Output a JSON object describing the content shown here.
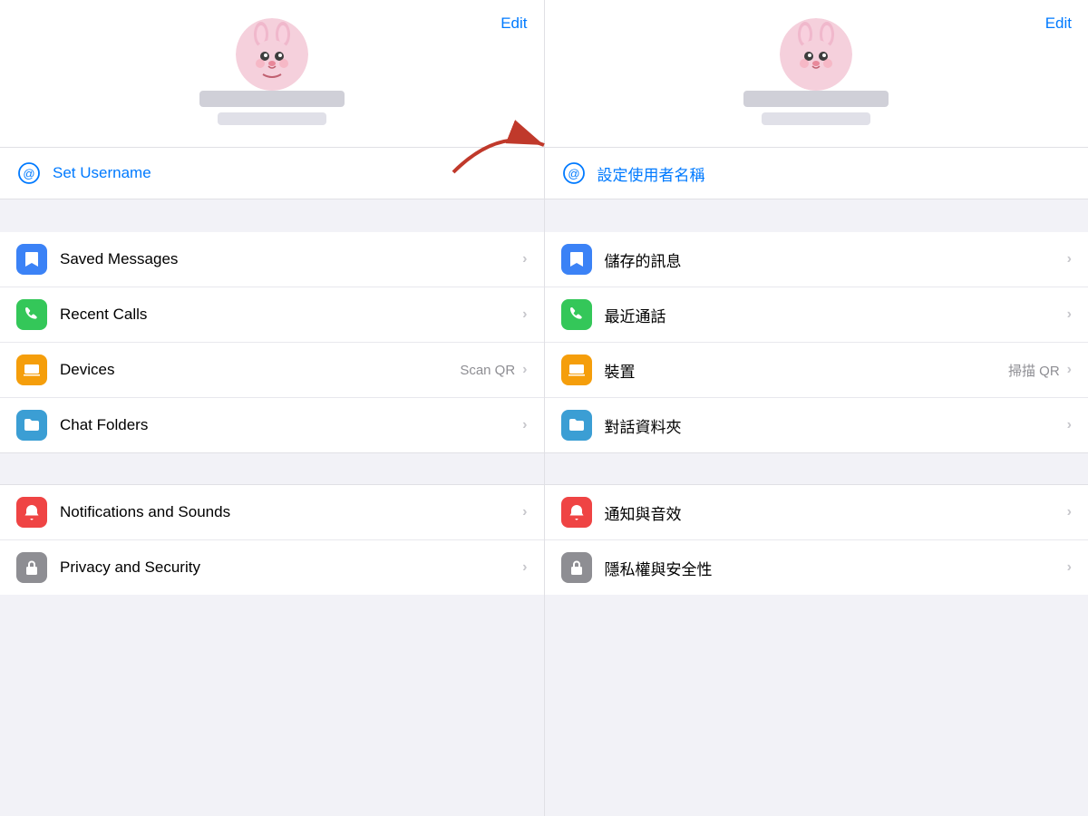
{
  "colors": {
    "blue": "#007aff",
    "green": "#34c759",
    "orange": "#f59e0b",
    "teal": "#3b9ed4",
    "red": "#ef4444",
    "gray": "#8e8e93"
  },
  "left_panel": {
    "edit_label": "Edit",
    "set_username_label": "Set Username",
    "menu_items": [
      {
        "id": "saved_messages",
        "label": "Saved Messages",
        "icon": "bookmark-icon",
        "icon_color": "blue",
        "secondary": "",
        "chevron": "›"
      },
      {
        "id": "recent_calls",
        "label": "Recent Calls",
        "icon": "phone-icon",
        "icon_color": "green",
        "secondary": "",
        "chevron": "›"
      },
      {
        "id": "devices",
        "label": "Devices",
        "icon": "laptop-icon",
        "icon_color": "orange",
        "secondary": "Scan QR",
        "chevron": "›"
      },
      {
        "id": "chat_folders",
        "label": "Chat Folders",
        "icon": "folder-icon",
        "icon_color": "teal",
        "secondary": "",
        "chevron": "›"
      }
    ],
    "menu_items2": [
      {
        "id": "notifications",
        "label": "Notifications and Sounds",
        "icon": "bell-icon",
        "icon_color": "red",
        "secondary": "",
        "chevron": "›"
      },
      {
        "id": "privacy",
        "label": "Privacy and Security",
        "icon": "lock-icon",
        "icon_color": "gray",
        "secondary": "",
        "chevron": "›"
      }
    ]
  },
  "right_panel": {
    "edit_label": "Edit",
    "set_username_label": "設定使用者名稱",
    "menu_items": [
      {
        "id": "saved_messages_zh",
        "label": "儲存的訊息",
        "icon": "bookmark-icon",
        "icon_color": "blue",
        "secondary": "",
        "chevron": "›"
      },
      {
        "id": "recent_calls_zh",
        "label": "最近通話",
        "icon": "phone-icon",
        "icon_color": "green",
        "secondary": "",
        "chevron": "›"
      },
      {
        "id": "devices_zh",
        "label": "裝置",
        "icon": "laptop-icon",
        "icon_color": "orange",
        "secondary": "掃描 QR",
        "chevron": "›"
      },
      {
        "id": "chat_folders_zh",
        "label": "對話資料夾",
        "icon": "folder-icon",
        "icon_color": "teal",
        "secondary": "",
        "chevron": "›"
      }
    ],
    "menu_items2": [
      {
        "id": "notifications_zh",
        "label": "通知與音效",
        "icon": "bell-icon",
        "icon_color": "red",
        "secondary": "",
        "chevron": "›"
      },
      {
        "id": "privacy_zh",
        "label": "隱私權與安全性",
        "icon": "lock-icon",
        "icon_color": "gray",
        "secondary": "",
        "chevron": "›"
      }
    ]
  }
}
